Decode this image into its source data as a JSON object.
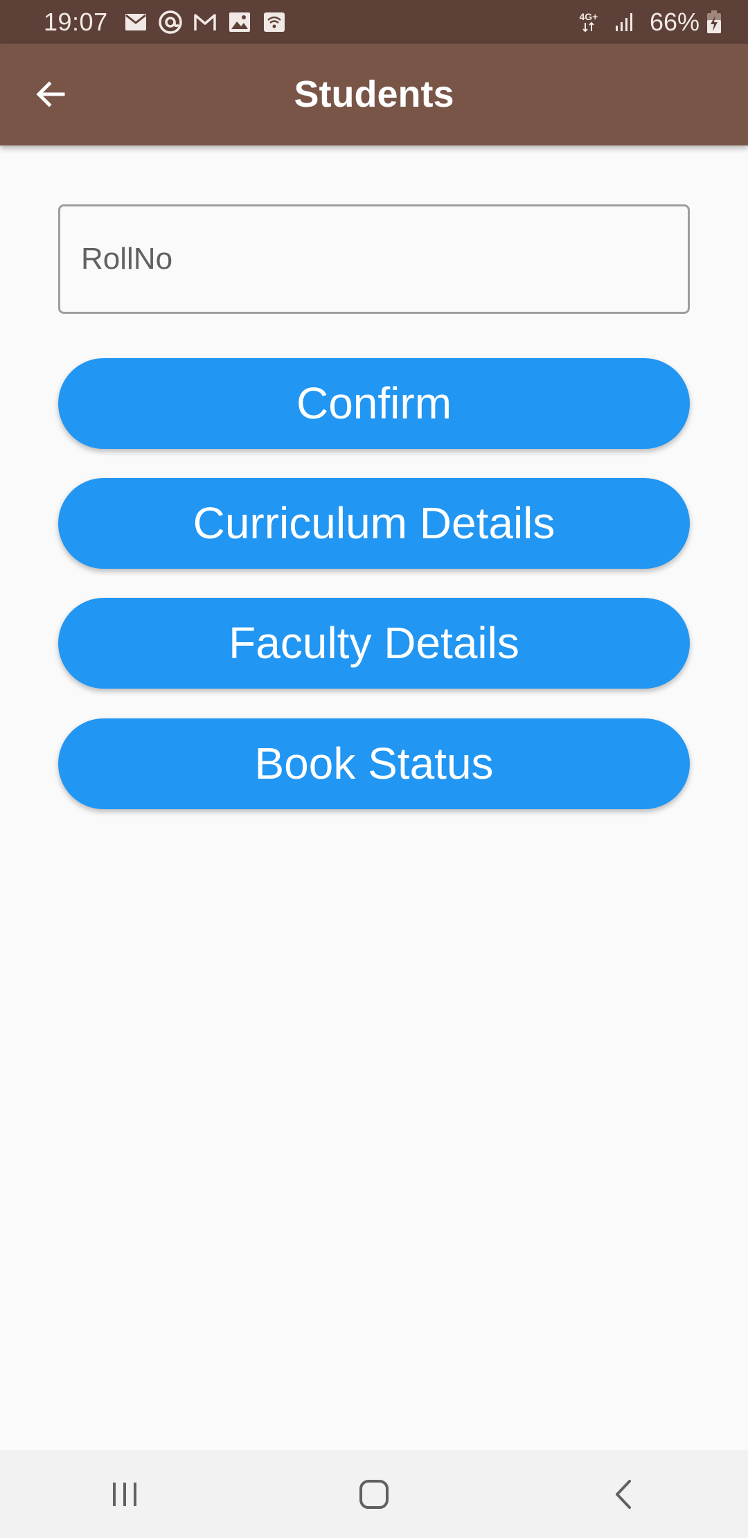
{
  "status_bar": {
    "time": "19:07",
    "network_label": "4G+",
    "battery_percent": "66%",
    "left_icons": [
      "mail-icon",
      "threads-icon",
      "gmail-icon",
      "gallery-icon",
      "wifi-hotspot-icon"
    ],
    "right_icons": [
      "network-4g-icon",
      "signal-icon",
      "battery-charging-icon"
    ]
  },
  "app_bar": {
    "title": "Students",
    "back_icon": "arrow-back-icon",
    "background": "#795548"
  },
  "form": {
    "rollno_placeholder": "RollNo",
    "rollno_value": ""
  },
  "buttons": {
    "confirm": "Confirm",
    "curriculum": "Curriculum Details",
    "faculty": "Faculty Details",
    "book_status": "Book Status",
    "color": "#2196f3"
  },
  "nav_bar": {
    "icons": [
      "recent-apps-icon",
      "home-icon",
      "back-icon"
    ]
  }
}
